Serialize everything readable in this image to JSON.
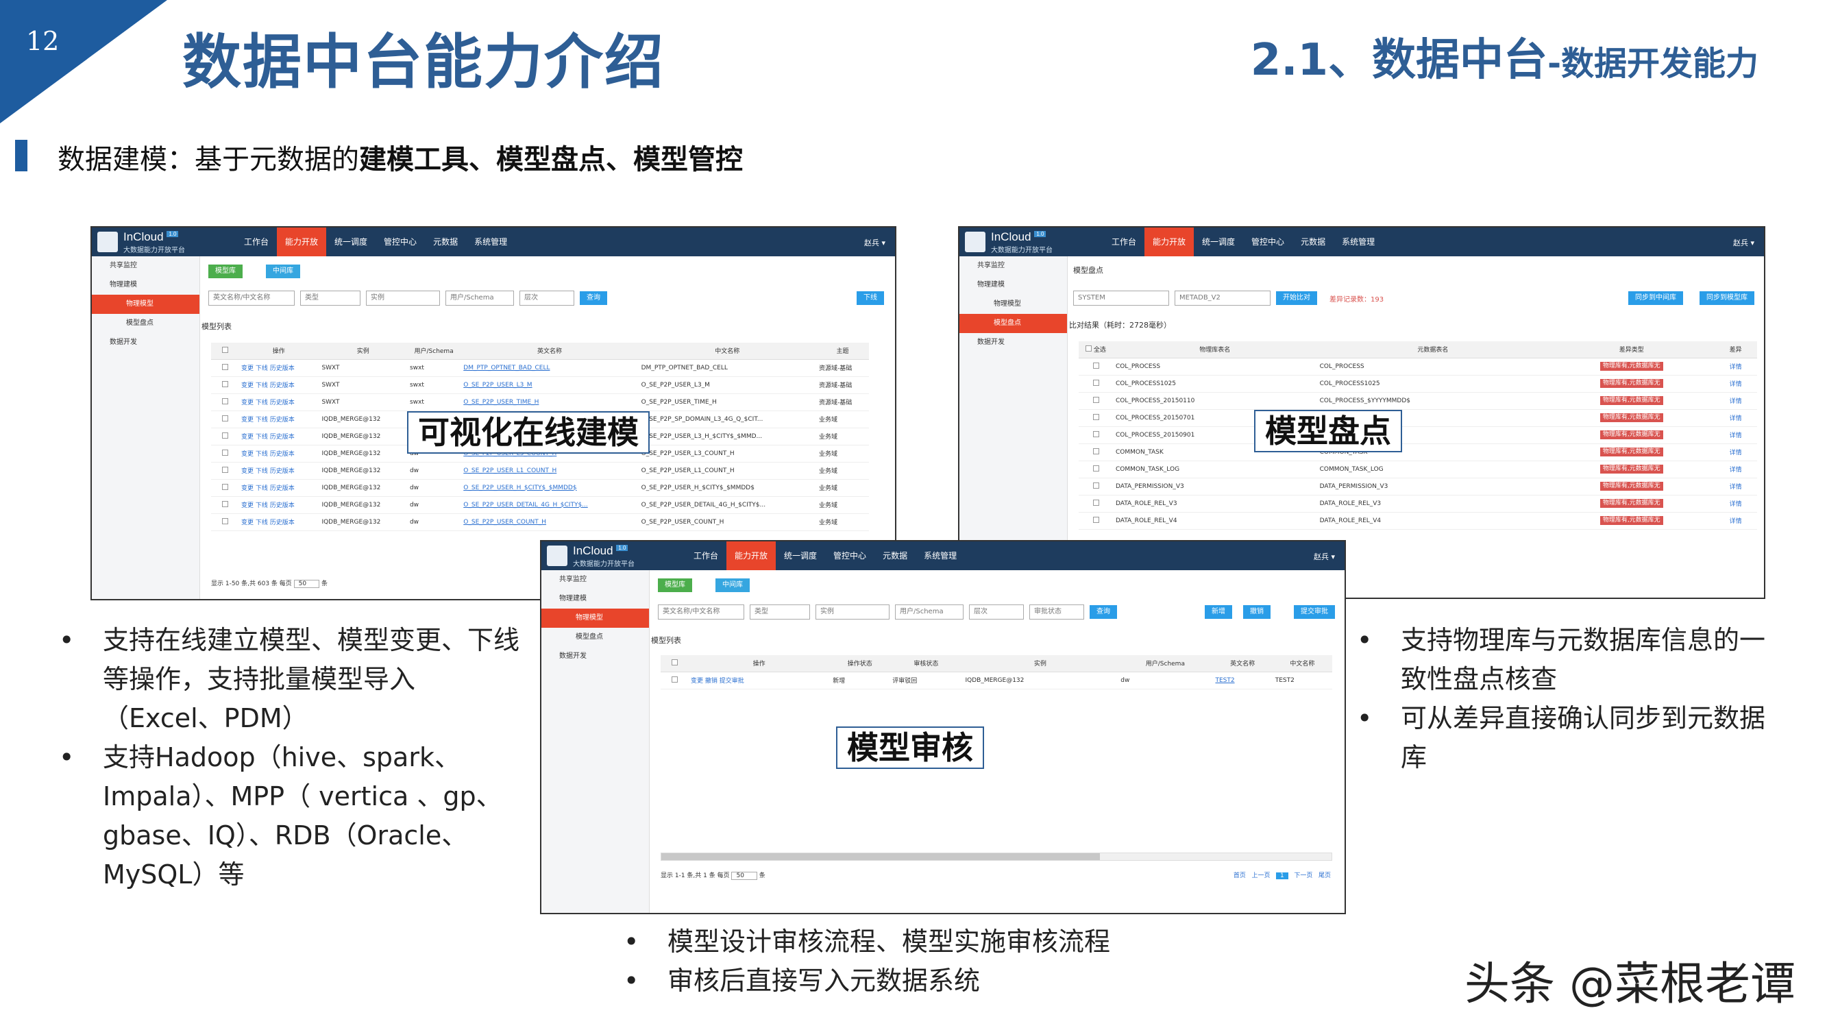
{
  "page": {
    "number": "12",
    "title": "数据中台能力介绍",
    "subtitle_main": "2.1、数据中台",
    "subtitle_tail": "-数据开发能力",
    "section_plain": "数据建模：基于元数据的",
    "section_bold": "建模工具、模型盘点、模型管控",
    "watermark": "头条 @菜根老谭",
    "accent_color": "#2e5e95",
    "nav_active_color": "#e8452b"
  },
  "app": {
    "logo_title": "InCloud",
    "logo_version": "1.0",
    "logo_subtitle": "大数据能力开放平台",
    "nav": [
      "工作台",
      "能力开放",
      "统一调度",
      "管控中心",
      "元数据",
      "系统管理"
    ],
    "user": "赵兵 ▾",
    "sidebar_items": [
      "共享监控",
      "物理建模",
      "物理模型",
      "模型盘点",
      "数据开发"
    ]
  },
  "shot1": {
    "tab_model_lib": "模型库",
    "tab_middle_lib": "中间库",
    "search_placeholder": "英文名称/中文名称",
    "filter_type": "类型",
    "filter_instance": "实例",
    "filter_schema": "用户/Schema",
    "filter_level": "层次",
    "query_button": "查询",
    "offline_button": "下线",
    "list_title": "模型列表",
    "columns": [
      "操作",
      "实例",
      "用户/Schema",
      "英文名称",
      "中文名称",
      "主题"
    ],
    "ops": [
      "变更",
      "下线",
      "历史版本"
    ],
    "rows": [
      [
        "SWXT",
        "swxt",
        "DM_PTP_OPTNET_BAD_CELL",
        "DM_PTP_OPTNET_BAD_CELL",
        "资源域-基础"
      ],
      [
        "SWXT",
        "swxt",
        "O_SE_P2P_USER_L3_M",
        "O_SE_P2P_USER_L3_M",
        "资源域-基础"
      ],
      [
        "SWXT",
        "swxt",
        "O_SE_P2P_USER_TIME_H",
        "O_SE_P2P_USER_TIME_H",
        "资源域-基础"
      ],
      [
        "IQDB_MERGE@132",
        "dw",
        "O_SE_P2P_SP_DOMAIN_L3_4G_Q",
        "O_SE_P2P_SP_DOMAIN_L3_4G_Q_$CIT...",
        "业务域"
      ],
      [
        "IQDB_MERGE@132",
        "dw",
        "O_SE_P2P_USER_L3_H",
        "O_SE_P2P_USER_L3_H_$CITY$_$MMD...",
        "业务域"
      ],
      [
        "IQDB_MERGE@132",
        "dw",
        "O_SE_P2P_USER_L3_COUNT_H",
        "O_SE_P2P_USER_L3_COUNT_H",
        "业务域"
      ],
      [
        "IQDB_MERGE@132",
        "dw",
        "O_SE_P2P_USER_L1_COUNT_H",
        "O_SE_P2P_USER_L1_COUNT_H",
        "业务域"
      ],
      [
        "IQDB_MERGE@132",
        "dw",
        "O_SE_P2P_USER_H_$CITY$_$MMDD$",
        "O_SE_P2P_USER_H_$CITY$_$MMDD$",
        "业务域"
      ],
      [
        "IQDB_MERGE@132",
        "dw",
        "O_SE_P2P_USER_DETAIL_4G_H_$CITY$...",
        "O_SE_P2P_USER_DETAIL_4G_H_$CITY$...",
        "业务域"
      ],
      [
        "IQDB_MERGE@132",
        "dw",
        "O_SE_P2P_USER_COUNT_H",
        "O_SE_P2P_USER_COUNT_H",
        "业务域"
      ]
    ],
    "pager_text": "显示 1-50 条,共 603 条 每页",
    "page_size": "50",
    "pager_unit": "条",
    "callout": "可视化在线建模"
  },
  "shot2": {
    "panel_title": "模型盘点",
    "schema_select": "SYSTEM",
    "metadb_select": "METADB_V2",
    "compare_button": "开始比对",
    "diff_label": "差异记录数：193",
    "sync_middle": "同步到中间库",
    "sync_model": "同步到模型库",
    "result_text": "比对结果（耗时：2728毫秒）",
    "columns": [
      "全选",
      "物理库表名",
      "元数据表名",
      "差异类型",
      "差异"
    ],
    "diff_badge": "物理库有,元数据库无",
    "detail_link": "详情",
    "rows": [
      [
        "COL_PROCESS",
        "COL_PROCESS"
      ],
      [
        "COL_PROCESS1025",
        "COL_PROCESS1025"
      ],
      [
        "COL_PROCESS_20150110",
        "COL_PROCESS_$YYYYMMDD$"
      ],
      [
        "COL_PROCESS_20150701",
        ""
      ],
      [
        "COL_PROCESS_20150901",
        ""
      ],
      [
        "COMMON_TASK",
        "COMMON_TASK"
      ],
      [
        "COMMON_TASK_LOG",
        "COMMON_TASK_LOG"
      ],
      [
        "DATA_PERMISSION_V3",
        "DATA_PERMISSION_V3"
      ],
      [
        "DATA_ROLE_REL_V3",
        "DATA_ROLE_REL_V3"
      ],
      [
        "DATA_ROLE_REL_V4",
        "DATA_ROLE_REL_V4"
      ]
    ],
    "callout": "模型盘点"
  },
  "shot3": {
    "tab_model_lib": "模型库",
    "tab_middle_lib": "中间库",
    "search_placeholder": "英文名称/中文名称",
    "filter_type": "类型",
    "filter_instance": "实例",
    "filter_schema": "用户/Schema",
    "filter_level": "层次",
    "filter_status": "审批状态",
    "query_button": "查询",
    "new_button": "新增",
    "revoke_button": "撤销",
    "submit_button": "提交审批",
    "list_title": "模型列表",
    "columns": [
      "操作",
      "操作状态",
      "审核状态",
      "实例",
      "用户/Schema",
      "英文名称",
      "中文名称"
    ],
    "row_ops": [
      "变更",
      "撤销",
      "提交审批"
    ],
    "row": [
      "新增",
      "评审驳回",
      "IQDB_MERGE@132",
      "dw",
      "TEST2",
      "TEST2"
    ],
    "pager_text": "显示 1-1 条,共 1 条 每页",
    "page_size": "50",
    "pager_unit": "条",
    "pager_first": "首页",
    "pager_prev": "上一页",
    "pager_current": "1",
    "pager_next": "下一页",
    "pager_last": "尾页",
    "callout": "模型审核"
  },
  "bullets_left": [
    "支持在线建立模型、模型变更、下线等操作，支持批量模型导入（Excel、PDM）",
    "支持Hadoop（hive、spark、Impala）、MPP（ vertica 、gp、gbase、IQ）、RDB（Oracle、MySQL）等"
  ],
  "bullets_right": [
    "支持物理库与元数据库信息的一致性盘点核查",
    "可从差异直接确认同步到元数据库"
  ],
  "bullets_bottom": [
    "模型设计审核流程、模型实施审核流程",
    "审核后直接写入元数据系统"
  ]
}
